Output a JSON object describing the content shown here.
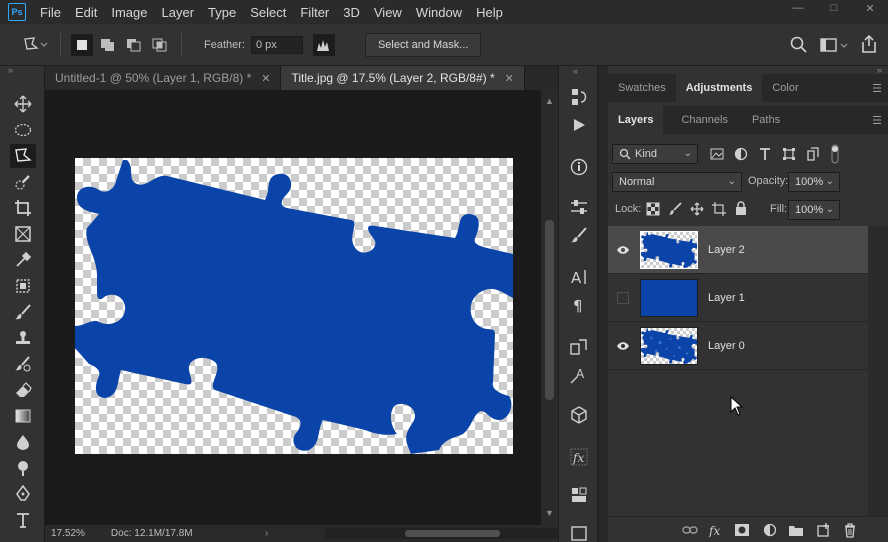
{
  "app": {
    "logo": "Ps"
  },
  "menu": [
    "File",
    "Edit",
    "Image",
    "Layer",
    "Type",
    "Select",
    "Filter",
    "3D",
    "View",
    "Window",
    "Help"
  ],
  "options": {
    "feather_label": "Feather:",
    "feather_value": "0 px",
    "select_mask_label": "Select and Mask..."
  },
  "tabs": [
    {
      "title": "Untitled-1 @ 50% (Layer 1, RGB/8) *",
      "active": false
    },
    {
      "title": "Title.jpg @ 17.5% (Layer 2, RGB/8#) *",
      "active": true
    }
  ],
  "status": {
    "zoom": "17.52%",
    "doc": "Doc: 12.1M/17.8M"
  },
  "panels": {
    "top_tabs": [
      "Swatches",
      "Adjustments",
      "Color"
    ],
    "top_active": "Adjustments",
    "layer_tabs": [
      "Layers",
      "Channels",
      "Paths"
    ],
    "layer_active": "Layers",
    "filter_kind": "Kind",
    "blend_mode": "Normal",
    "opacity_label": "Opacity:",
    "opacity_value": "100%",
    "lock_label": "Lock:",
    "fill_label": "Fill:",
    "fill_value": "100%"
  },
  "layers": [
    {
      "name": "Layer 2",
      "visible": true,
      "selected": true,
      "thumb": "puzzle"
    },
    {
      "name": "Layer 1",
      "visible": false,
      "selected": false,
      "thumb": "solid"
    },
    {
      "name": "Layer 0",
      "visible": true,
      "selected": false,
      "thumb": "pattern"
    }
  ],
  "colors": {
    "puzzle_blue": "#0a44a8",
    "accent": "#31a8ff"
  }
}
